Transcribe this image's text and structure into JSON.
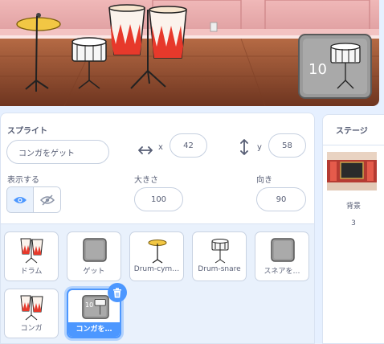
{
  "stage": {
    "sprite_badge_number": "10"
  },
  "sprite_info": {
    "section_title": "スプライト",
    "name_value": "コンガをゲット",
    "x_label": "x",
    "x_value": "42",
    "y_label": "y",
    "y_value": "58",
    "show_label": "表示する",
    "size_label": "大きさ",
    "size_value": "100",
    "direction_label": "向き",
    "direction_value": "90"
  },
  "sprites": [
    {
      "name": "ドラム",
      "thumb": "conga-thumb"
    },
    {
      "name": "ゲット",
      "thumb": "gray-square-thumb"
    },
    {
      "name": "Drum-cym…",
      "thumb": "cymbal-thumb"
    },
    {
      "name": "Drum-snare",
      "thumb": "snare-thumb"
    },
    {
      "name": "スネアを…",
      "thumb": "gray-square-thumb"
    },
    {
      "name": "コンガ",
      "thumb": "conga-thumb"
    },
    {
      "name": "コンガを…",
      "thumb": "snare-10-thumb",
      "selected": true,
      "badge": "10"
    }
  ],
  "stage_panel": {
    "title": "ステージ",
    "backdrop_label": "背景",
    "backdrop_count": "3"
  },
  "colors": {
    "accent": "#4c97ff",
    "stage_wall": "#e8a6a8",
    "stage_floor": "#8b4a2c"
  }
}
